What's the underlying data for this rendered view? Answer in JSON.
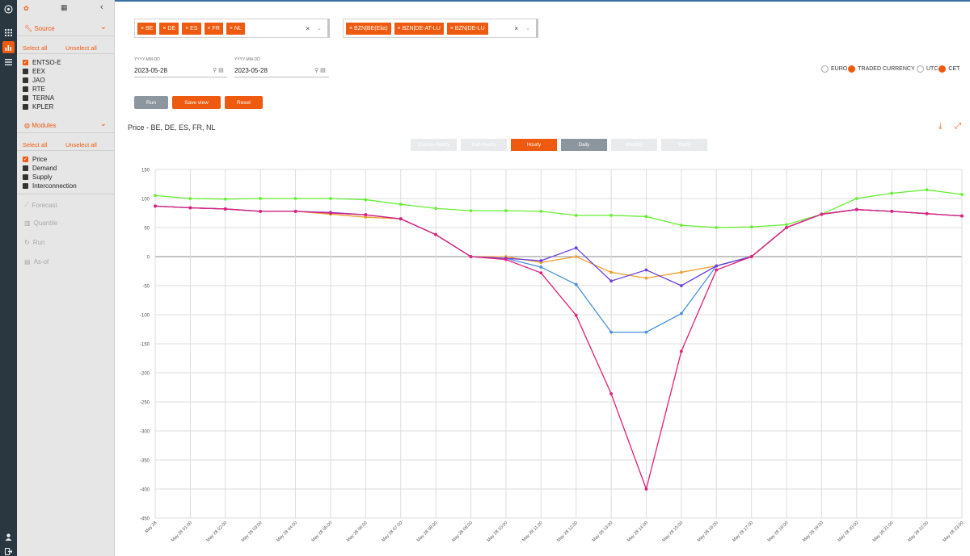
{
  "rail": {
    "icons": [
      "settings-icon",
      "grid-icon",
      "chart-icon",
      "menu-icon",
      "user-icon",
      "logout-icon"
    ]
  },
  "panel": {
    "source": {
      "title": "Source",
      "select_all": "Select all",
      "unselect_all": "Unselect all",
      "items": [
        {
          "label": "ENTSO-E",
          "checked": true
        },
        {
          "label": "EEX",
          "checked": false
        },
        {
          "label": "JAO",
          "checked": false
        },
        {
          "label": "RTE",
          "checked": false
        },
        {
          "label": "TERNA",
          "checked": false
        },
        {
          "label": "KPLER",
          "checked": false
        }
      ]
    },
    "modules": {
      "title": "Modules",
      "select_all": "Select all",
      "unselect_all": "Unselect all",
      "items": [
        {
          "label": "Price",
          "checked": true
        },
        {
          "label": "Demand",
          "checked": false
        },
        {
          "label": "Supply",
          "checked": false
        },
        {
          "label": "Interconnection",
          "checked": false
        }
      ]
    },
    "links": [
      "Forecast",
      "Quantile",
      "Run",
      "As-of"
    ]
  },
  "filters": {
    "countries": [
      "× BE",
      "× DE",
      "× ES",
      "× FR",
      "× NL"
    ],
    "zones": [
      "× BZN|BE(Elia)",
      "× BZN|DE-AT-LU",
      "× BZN|DE-LU"
    ],
    "clear": "×",
    "dropdown": "⌄"
  },
  "dates": {
    "placeholder": "YYYY-MM-DD",
    "from": "2023-05-28",
    "to": "2023-05-28"
  },
  "buttons": {
    "run": "Run",
    "save_view": "Save view",
    "reset": "Reset"
  },
  "currency": {
    "option1": "EURO",
    "option2": "TRADED CURRENCY",
    "selected": "TRADED CURRENCY"
  },
  "timezone": {
    "option1": "UTC",
    "option2": "CET",
    "selected": "CET"
  },
  "chart_title": "Price - BE, DE, ES, FR, NL",
  "granularity": {
    "options": [
      "Quarter-Hourly",
      "Half-Hourly",
      "Hourly",
      "Daily",
      "Monthly",
      "Yearly"
    ],
    "selected": "Hourly"
  },
  "chart_data": {
    "type": "line",
    "x": [
      "May 28",
      "May 28 01:00",
      "May 28 02:00",
      "May 28 03:00",
      "May 28 04:00",
      "May 28 05:00",
      "May 28 06:00",
      "May 28 07:00",
      "May 28 08:00",
      "May 28 09:00",
      "May 28 10:00",
      "May 28 11:00",
      "May 28 12:00",
      "May 28 13:00",
      "May 28 14:00",
      "May 28 15:00",
      "May 28 16:00",
      "May 28 17:00",
      "May 28 18:00",
      "May 28 19:00",
      "May 28 20:00",
      "May 28 21:00",
      "May 28 22:00",
      "May 28 23:00"
    ],
    "ylim": [
      -450,
      150
    ],
    "yticks": [
      150,
      100,
      50,
      0,
      -50,
      -100,
      -150,
      -200,
      -250,
      -300,
      -350,
      -400,
      -450
    ],
    "grid": true,
    "series": [
      {
        "color": "#66ee33",
        "values": [
          105,
          100,
          99,
          100,
          100,
          100,
          98,
          90,
          83,
          79,
          79,
          78,
          71,
          71,
          69,
          54,
          50,
          51,
          55,
          73,
          100,
          109,
          115,
          107
        ]
      },
      {
        "color": "#f0a030",
        "values": [
          87,
          84,
          82,
          78,
          78,
          73,
          68,
          65,
          38,
          0,
          0,
          -10,
          0,
          -27,
          -37,
          -27,
          -16,
          0,
          50,
          73,
          81,
          78,
          74,
          70
        ]
      },
      {
        "color": "#4a90e2",
        "values": [
          87,
          84,
          82,
          78,
          78,
          75,
          72,
          65,
          38,
          0,
          -3,
          -18,
          -48,
          -130,
          -130,
          -98,
          -16,
          0,
          50,
          73,
          81,
          78,
          74,
          70
        ]
      },
      {
        "color": "#6a3ee0",
        "values": [
          87,
          84,
          82,
          78,
          78,
          76,
          72,
          65,
          38,
          0,
          -3,
          -7,
          15,
          -42,
          -23,
          -50,
          -16,
          0,
          50,
          73,
          81,
          78,
          74,
          70
        ]
      },
      {
        "color": "#e0207a",
        "values": [
          87,
          84,
          82,
          78,
          78,
          75,
          72,
          65,
          38,
          0,
          -5,
          -28,
          -101,
          -236,
          -400,
          -163,
          -23,
          0,
          50,
          73,
          81,
          78,
          74,
          70
        ]
      }
    ]
  }
}
